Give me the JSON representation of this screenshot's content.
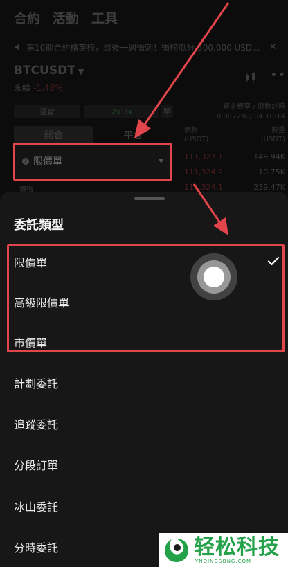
{
  "nav": {
    "items": [
      "合約",
      "活動",
      "工具"
    ]
  },
  "announcement": {
    "text": "第10期合約精英榜，最後一週衝刺！衝榜瓜分 500,000 USD..."
  },
  "market": {
    "symbol": "BTCUSDT",
    "contract_type": "永續",
    "change": "-1.48%"
  },
  "controls": {
    "margin_mode": "逐倉",
    "leverage": "2x 3x",
    "mode": "單"
  },
  "funding": {
    "label": "資金費率 / 倒數計時",
    "value": "0.0072% / 04:10:14"
  },
  "trade_tabs": [
    "開倉",
    "平倉"
  ],
  "orderbook": {
    "price_header": "價格",
    "price_unit": "(USDT)",
    "qty_header": "數量",
    "qty_unit": "(USDT)",
    "rows": [
      {
        "price": "111,327.1",
        "qty": "149.94K"
      },
      {
        "price": "111,324.2",
        "qty": "10.75K"
      },
      {
        "price": "111,324.1",
        "qty": "239.47K"
      }
    ]
  },
  "order_form": {
    "order_type": "限價單",
    "price_label": "價格"
  },
  "sheet": {
    "title": "委託類型",
    "options": [
      "限價單",
      "高級限價單",
      "市價單",
      "計劃委託",
      "追蹤委託",
      "分段訂單",
      "冰山委託",
      "分時委託"
    ],
    "selected_index": 0
  },
  "watermark": {
    "cn": "轻松科技",
    "en": "YNQINGSONG.COM"
  },
  "colors": {
    "annotation": "#e2454b",
    "sheet_bg": "#171717",
    "watermark_green": "#24a24a"
  }
}
